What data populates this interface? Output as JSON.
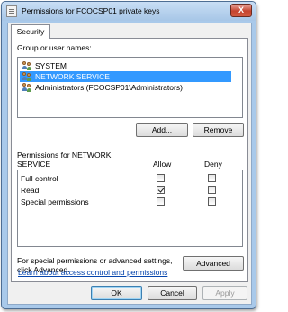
{
  "window": {
    "title": "Permissions for FCOCSP01 private keys",
    "close_symbol": "X"
  },
  "tabs": [
    {
      "label": "Security"
    }
  ],
  "group": {
    "label": "Group or user names:",
    "users": [
      {
        "name": "SYSTEM",
        "icon": "users-icon",
        "selected": false
      },
      {
        "name": "NETWORK SERVICE",
        "icon": "users-icon",
        "selected": true
      },
      {
        "name": "Administrators (FCOCSP01\\Administrators)",
        "icon": "users-icon",
        "selected": false
      }
    ],
    "add_label": "Add...",
    "remove_label": "Remove"
  },
  "permissions": {
    "label_line1": "Permissions for NETWORK",
    "label_line2": "SERVICE",
    "allow_header": "Allow",
    "deny_header": "Deny",
    "rows": [
      {
        "name": "Full control",
        "allow": false,
        "deny": false
      },
      {
        "name": "Read",
        "allow": true,
        "deny": false
      },
      {
        "name": "Special permissions",
        "allow": false,
        "deny": false
      }
    ]
  },
  "advanced": {
    "text_line1": "For special permissions or advanced settings,",
    "text_line2": "click Advanced.",
    "button_label": "Advanced"
  },
  "help_link": "Learn about access control and permissions",
  "footer": {
    "ok_label": "OK",
    "cancel_label": "Cancel",
    "apply_label": "Apply",
    "apply_enabled": false
  },
  "colors": {
    "selection": "#3399ff",
    "link": "#0645ad",
    "title_bar": "#a9c9ea"
  }
}
